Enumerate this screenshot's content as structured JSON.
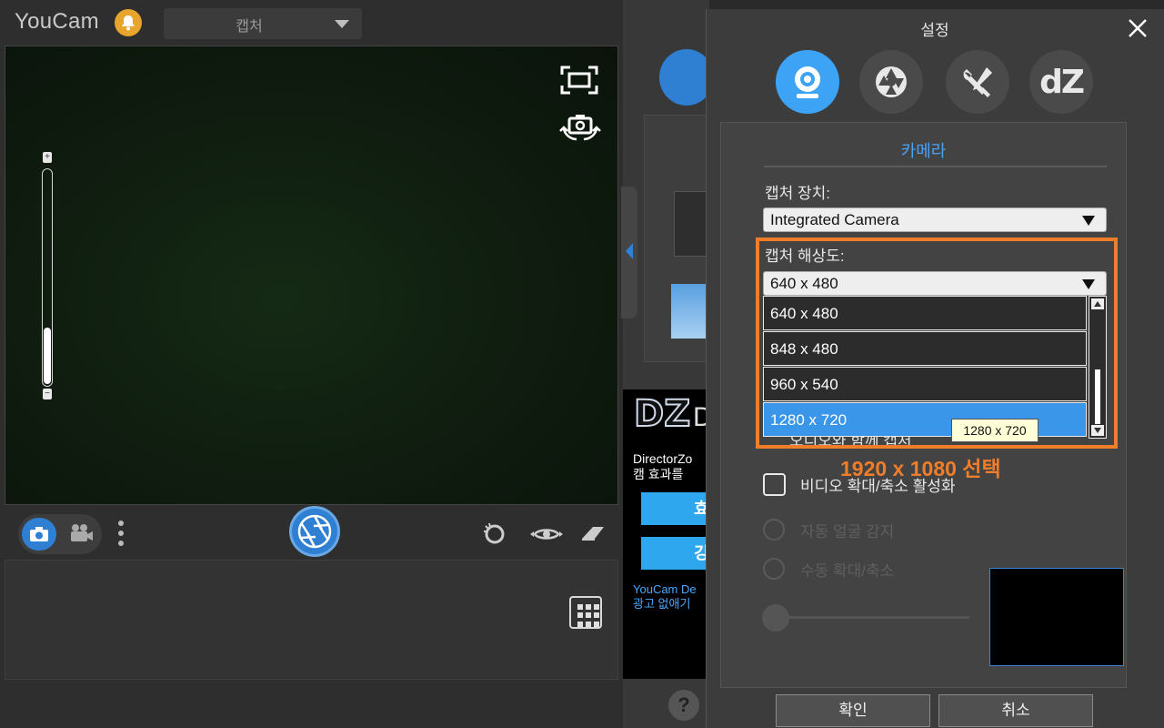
{
  "app": {
    "logo": "YouCam",
    "mode_dropdown": "캡처"
  },
  "middle": {
    "ad_logo_mark": "DZ",
    "ad_logo_text": "D",
    "ad_line1": "DirectorZo",
    "ad_line2": "캠 효과를",
    "ad_button1": "효",
    "ad_button2": "깅",
    "ad_footer1": "YouCam De",
    "ad_footer2": "광고 없애기",
    "help": "?"
  },
  "dialog": {
    "title": "설정",
    "tabs": [
      "camera",
      "capture",
      "tools",
      "dZ"
    ],
    "tab_dz_label": "dZ",
    "section_title": "카메라",
    "device_label": "캡처 장치:",
    "device_value": "Integrated Camera",
    "resolution_label": "캡처 해상도:",
    "resolution_value": "640 x 480",
    "resolution_options": [
      "640 x 480",
      "848 x 480",
      "960 x 540",
      "1280 x 720"
    ],
    "selected_option": "1280 x 720",
    "tooltip": "1280 x 720",
    "hidden_row_text": "오디오와 함께 캡처",
    "annotation": "1920 x 1080 선택",
    "zoom_checkbox_label": "비디오 확대/축소 활성화",
    "radio_auto_label": "자동 얼굴 감지",
    "radio_manual_label": "수동 확대/축소",
    "ok": "확인",
    "cancel": "취소"
  },
  "colors": {
    "accent_blue": "#3da4f5",
    "highlight_orange": "#ef7d2a",
    "selected_row": "#3a96e8"
  }
}
